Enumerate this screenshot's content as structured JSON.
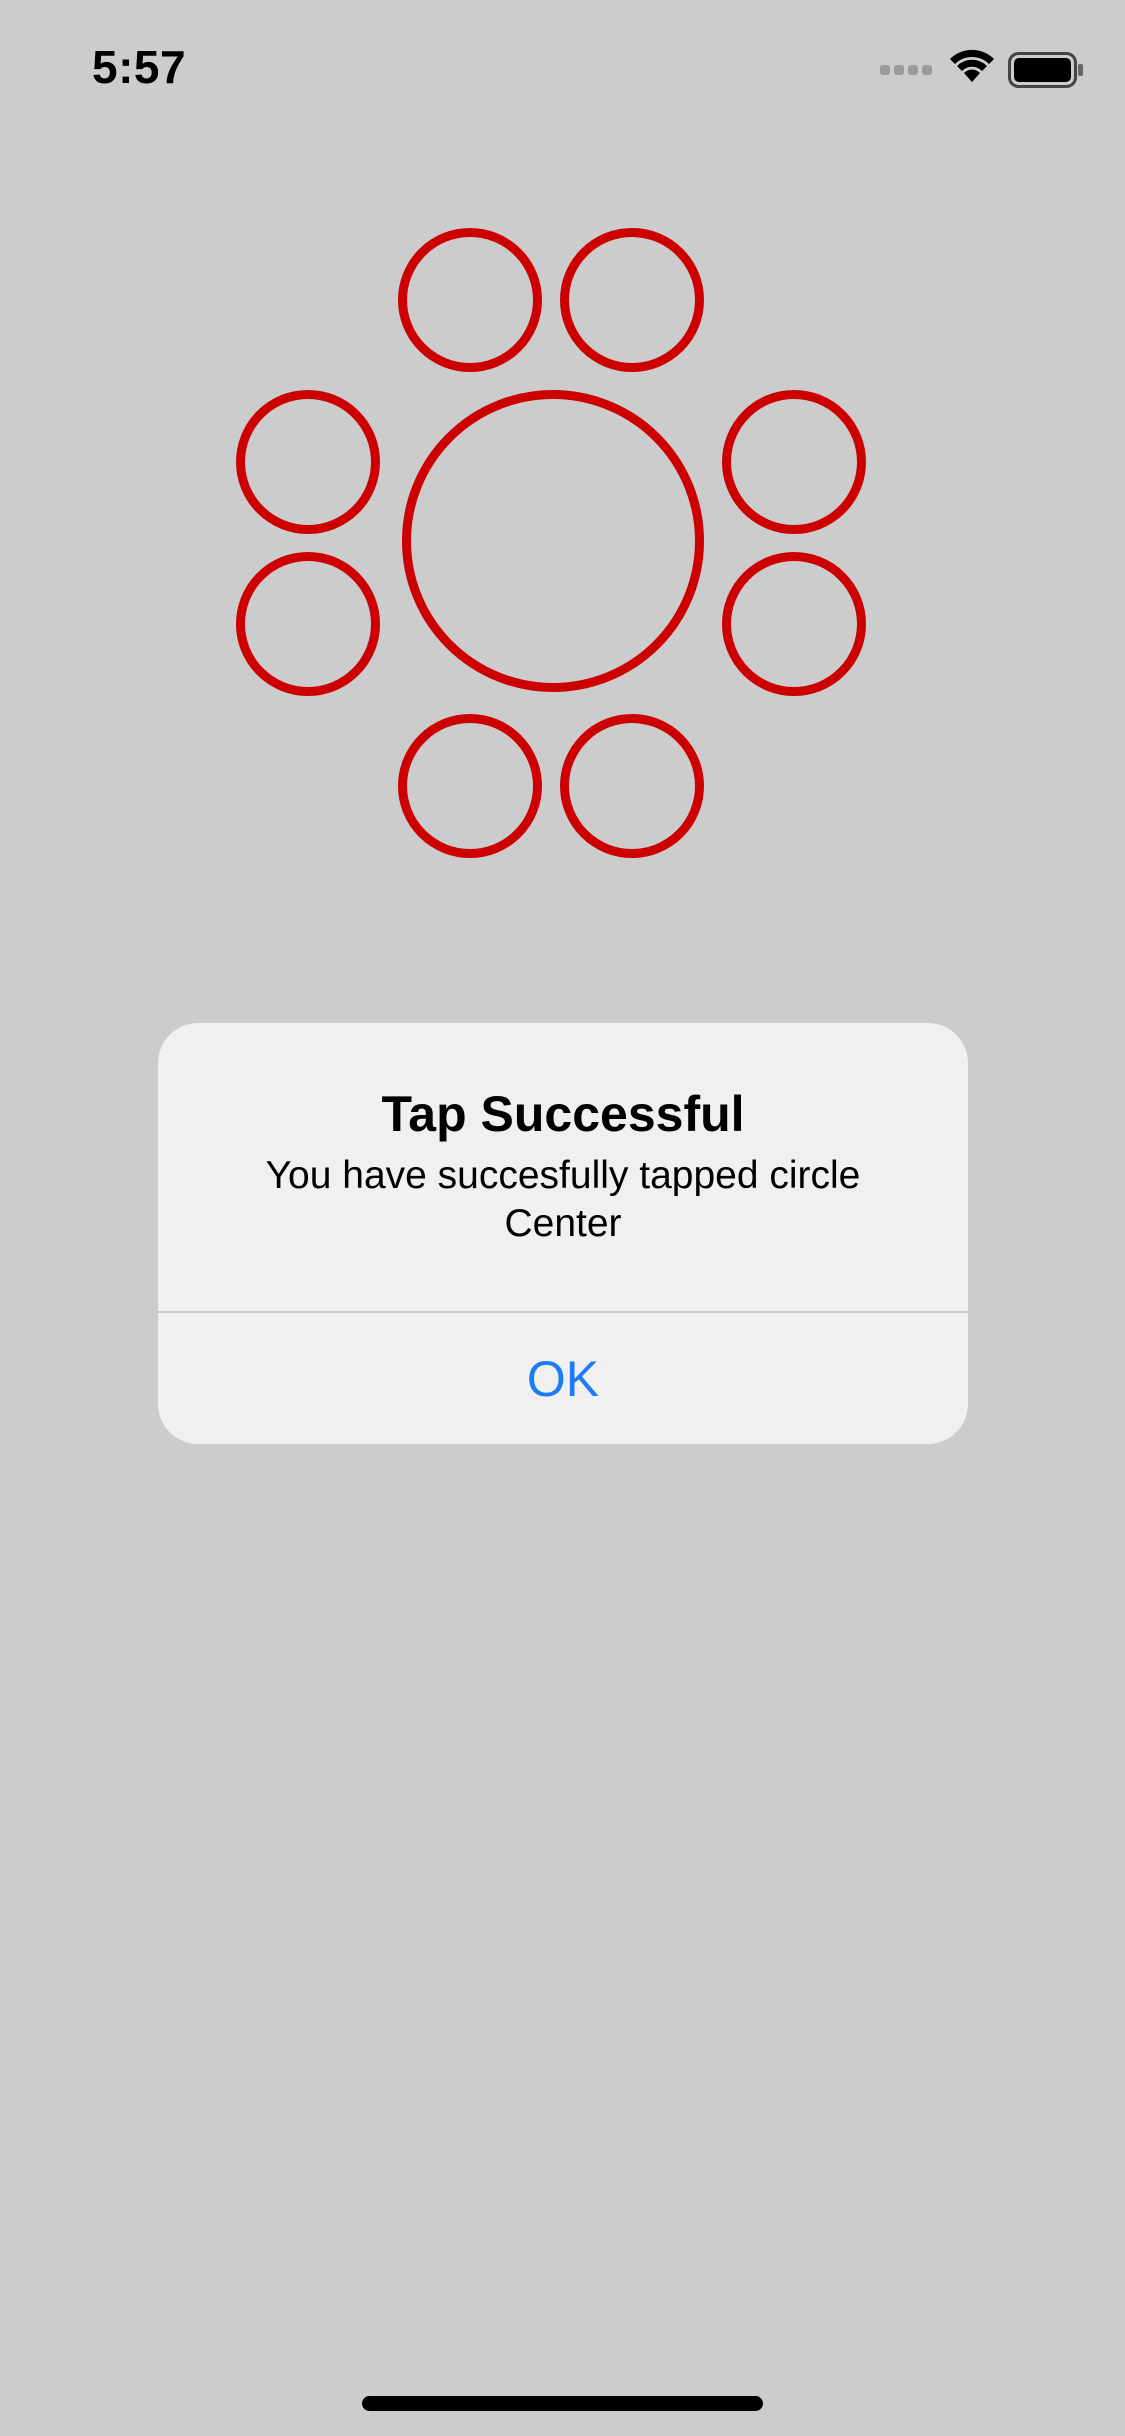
{
  "status_bar": {
    "time": "5:57"
  },
  "circles": {
    "color": "#cc0000",
    "count": 9
  },
  "alert": {
    "title": "Tap Successful",
    "message": "You have succesfully tapped circle Center",
    "button_label": "OK",
    "button_color": "#1e7cf2"
  }
}
